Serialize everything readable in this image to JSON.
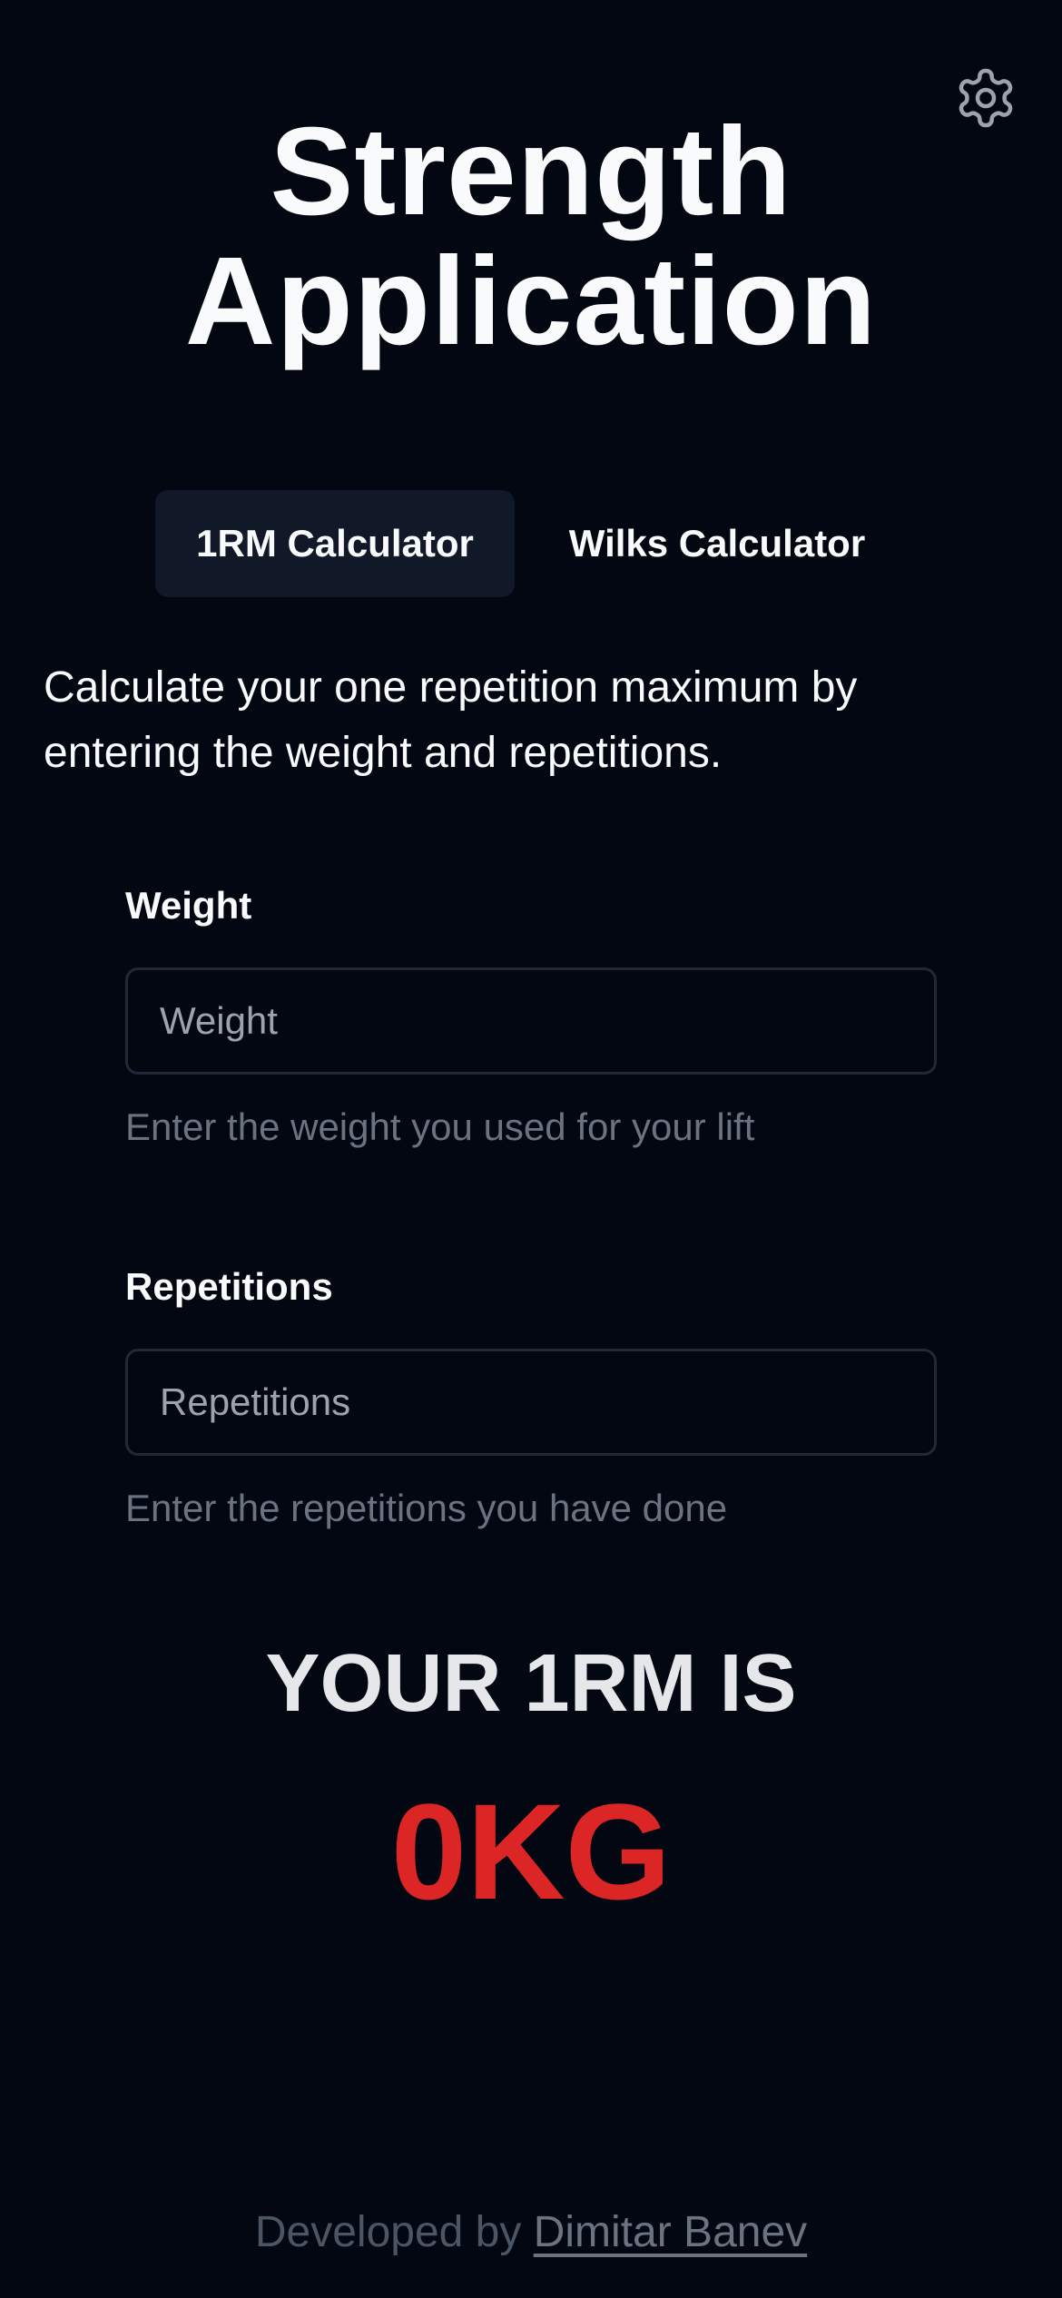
{
  "app": {
    "title": "Strength Application"
  },
  "header": {
    "settings_icon": "gear-icon"
  },
  "tabs": [
    {
      "label": "1RM Calculator",
      "active": true
    },
    {
      "label": "Wilks Calculator",
      "active": false
    }
  ],
  "description": "Calculate your one repetition maximum by entering the weight and repetitions.",
  "form": {
    "weight": {
      "label": "Weight",
      "value": "",
      "placeholder": "Weight",
      "help": "Enter the weight you used for your lift"
    },
    "repetitions": {
      "label": "Repetitions",
      "value": "",
      "placeholder": "Repetitions",
      "help": "Enter the repetitions you have done"
    }
  },
  "result": {
    "label": "YOUR 1RM IS",
    "value": "0KG"
  },
  "footer": {
    "prefix": "Developed by ",
    "author": "Dimitar Banev"
  },
  "colors": {
    "background": "#030712",
    "accent": "#dc2626",
    "tab_active_bg": "#111827"
  }
}
